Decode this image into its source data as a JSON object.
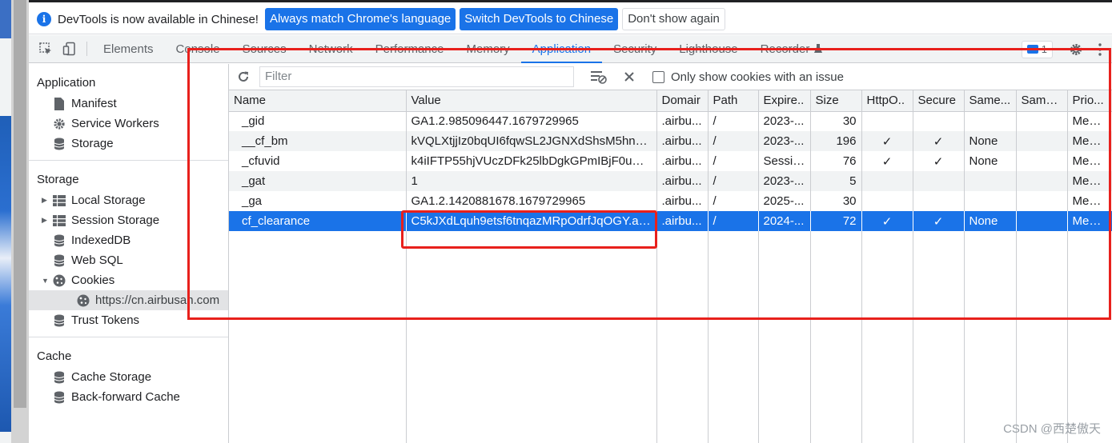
{
  "infobar": {
    "message": "DevTools is now available in Chinese!",
    "btn_match": "Always match Chrome's language",
    "btn_switch": "Switch DevTools to Chinese",
    "btn_dismiss": "Don't show again"
  },
  "tabs": [
    "Elements",
    "Console",
    "Sources",
    "Network",
    "Performance",
    "Memory",
    "Application",
    "Security",
    "Lighthouse",
    "Recorder"
  ],
  "active_tab": "Application",
  "issues_count": "1",
  "sidebar": {
    "application_title": "Application",
    "application_items": [
      "Manifest",
      "Service Workers",
      "Storage"
    ],
    "storage_title": "Storage",
    "storage_items": {
      "local_storage": "Local Storage",
      "session_storage": "Session Storage",
      "indexeddb": "IndexedDB",
      "web_sql": "Web SQL",
      "cookies": "Cookies",
      "cookie_origin": "https://cn.airbusan.com",
      "trust_tokens": "Trust Tokens"
    },
    "cache_title": "Cache",
    "cache_items": [
      "Cache Storage",
      "Back-forward Cache"
    ]
  },
  "toolbar": {
    "filter_placeholder": "Filter",
    "only_issues_label": "Only show cookies with an issue"
  },
  "columns": [
    "Name",
    "Value",
    "Domain",
    "Path",
    "Expires...",
    "Size",
    "HttpOnly",
    "Secure",
    "SameSite",
    "SameParty",
    "Priority"
  ],
  "columns_display": [
    "Name",
    "Value",
    "Domair",
    "Path",
    "Expire..",
    "Size",
    "HttpO..",
    "Secure",
    "Same...",
    "Same...",
    "Prio..."
  ],
  "cookies": [
    {
      "name": "_gid",
      "value": "GA1.2.985096447.1679729965",
      "domain": ".airbu...",
      "path": "/",
      "expires": "2023-...",
      "size": "30",
      "httponly": "",
      "secure": "",
      "samesite": "",
      "sameparty": "",
      "priority": "Mediu..."
    },
    {
      "name": "__cf_bm",
      "value": "kVQLXtjjIz0bqUI6fqwSL2JGNXdShsM5hnJe...",
      "domain": ".airbu...",
      "path": "/",
      "expires": "2023-...",
      "size": "196",
      "httponly": "✓",
      "secure": "✓",
      "samesite": "None",
      "sameparty": "",
      "priority": "Mediu..."
    },
    {
      "name": "_cfuvid",
      "value": "k4iIFTP55hjVUczDFk25lbDgkGPmIBjF0uVNd...",
      "domain": ".airbu...",
      "path": "/",
      "expires": "Session",
      "size": "76",
      "httponly": "✓",
      "secure": "✓",
      "samesite": "None",
      "sameparty": "",
      "priority": "Mediu..."
    },
    {
      "name": "_gat",
      "value": "1",
      "domain": ".airbu...",
      "path": "/",
      "expires": "2023-...",
      "size": "5",
      "httponly": "",
      "secure": "",
      "samesite": "",
      "sameparty": "",
      "priority": "Mediu..."
    },
    {
      "name": "_ga",
      "value": "GA1.2.1420881678.1679729965",
      "domain": ".airbu...",
      "path": "/",
      "expires": "2025-...",
      "size": "30",
      "httponly": "",
      "secure": "",
      "samesite": "",
      "sameparty": "",
      "priority": "Mediu..."
    },
    {
      "name": "cf_clearance",
      "value": "C5kJXdLquh9etsf6tnqazMRpOdrfJqOGY.aQ...",
      "domain": ".airbu...",
      "path": "/",
      "expires": "2024-...",
      "size": "72",
      "httponly": "✓",
      "secure": "✓",
      "samesite": "None",
      "sameparty": "",
      "priority": "Mediu..."
    }
  ],
  "selected_row": 5,
  "watermark": "CSDN @西楚傲天",
  "colors": {
    "accent": "#1a73e8",
    "annotation": "#e8201c"
  }
}
